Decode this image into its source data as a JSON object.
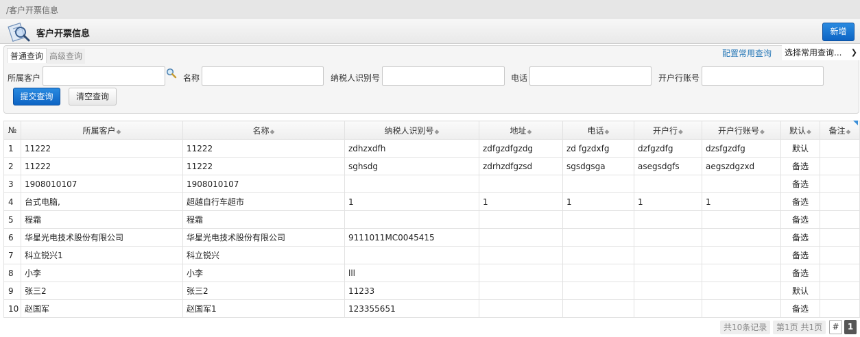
{
  "breadcrumb": {
    "separator": "/",
    "text": "客户开票信息"
  },
  "header": {
    "title": "客户开票信息",
    "new_button": "新增"
  },
  "query": {
    "tabs": [
      {
        "label": "普通查询",
        "active": true
      },
      {
        "label": "高级查询",
        "active": false
      }
    ],
    "config_link": "配置常用查询",
    "preset_select": "选择常用查询...",
    "fields": [
      {
        "label": "所属客户",
        "value": ""
      },
      {
        "label": "名称",
        "value": ""
      },
      {
        "label": "纳税人识别号",
        "value": ""
      },
      {
        "label": "电话",
        "value": ""
      },
      {
        "label": "开户行账号",
        "value": ""
      }
    ],
    "submit_button": "提交查询",
    "clear_button": "清空查询"
  },
  "table": {
    "columns": [
      "№",
      "所属客户",
      "名称",
      "纳税人识别号",
      "地址",
      "电话",
      "开户行",
      "开户行账号",
      "默认",
      "备注"
    ],
    "rows": [
      [
        "1",
        "11222",
        "11222",
        "zdhzxdfh",
        "zdfgzdfgzdg",
        "zd fgzdxfg",
        "dzfgzdfg",
        "dzsfgzdfg",
        "默认",
        ""
      ],
      [
        "2",
        "11222",
        "11222",
        "sghsdg",
        "zdrhzdfgzsd",
        "sgsdgsga",
        "asegsdgfs",
        "aegszdgzxd",
        "备选",
        ""
      ],
      [
        "3",
        "1908010107",
        "1908010107",
        "",
        "",
        "",
        "",
        "",
        "备选",
        ""
      ],
      [
        "4",
        "台式电脑,",
        "超越自行车超市",
        "1",
        "1",
        "1",
        "1",
        "1",
        "备选",
        ""
      ],
      [
        "5",
        "程霜",
        "程霜",
        "",
        "",
        "",
        "",
        "",
        "备选",
        ""
      ],
      [
        "6",
        "华星光电技术股份有限公司",
        "华星光电技术股份有限公司",
        "9111011MC0045415",
        "",
        "",
        "",
        "",
        "备选",
        ""
      ],
      [
        "7",
        "科立锐兴1",
        "科立锐兴",
        "",
        "",
        "",
        "",
        "",
        "备选",
        ""
      ],
      [
        "8",
        "小李",
        "小李",
        "lll",
        "",
        "",
        "",
        "",
        "备选",
        ""
      ],
      [
        "9",
        "张三2",
        "张三2",
        "11233",
        "",
        "",
        "",
        "",
        "默认",
        ""
      ],
      [
        "10",
        "赵国军",
        "赵国军1",
        "123355651",
        "",
        "",
        "",
        "",
        "备选",
        ""
      ]
    ]
  },
  "pager": {
    "total": "共10条记录",
    "pages": "第1页 共1页",
    "jump": "#",
    "current": "1"
  },
  "colors": {
    "primary_button": "#1a74d2",
    "link": "#2a7ab8"
  }
}
